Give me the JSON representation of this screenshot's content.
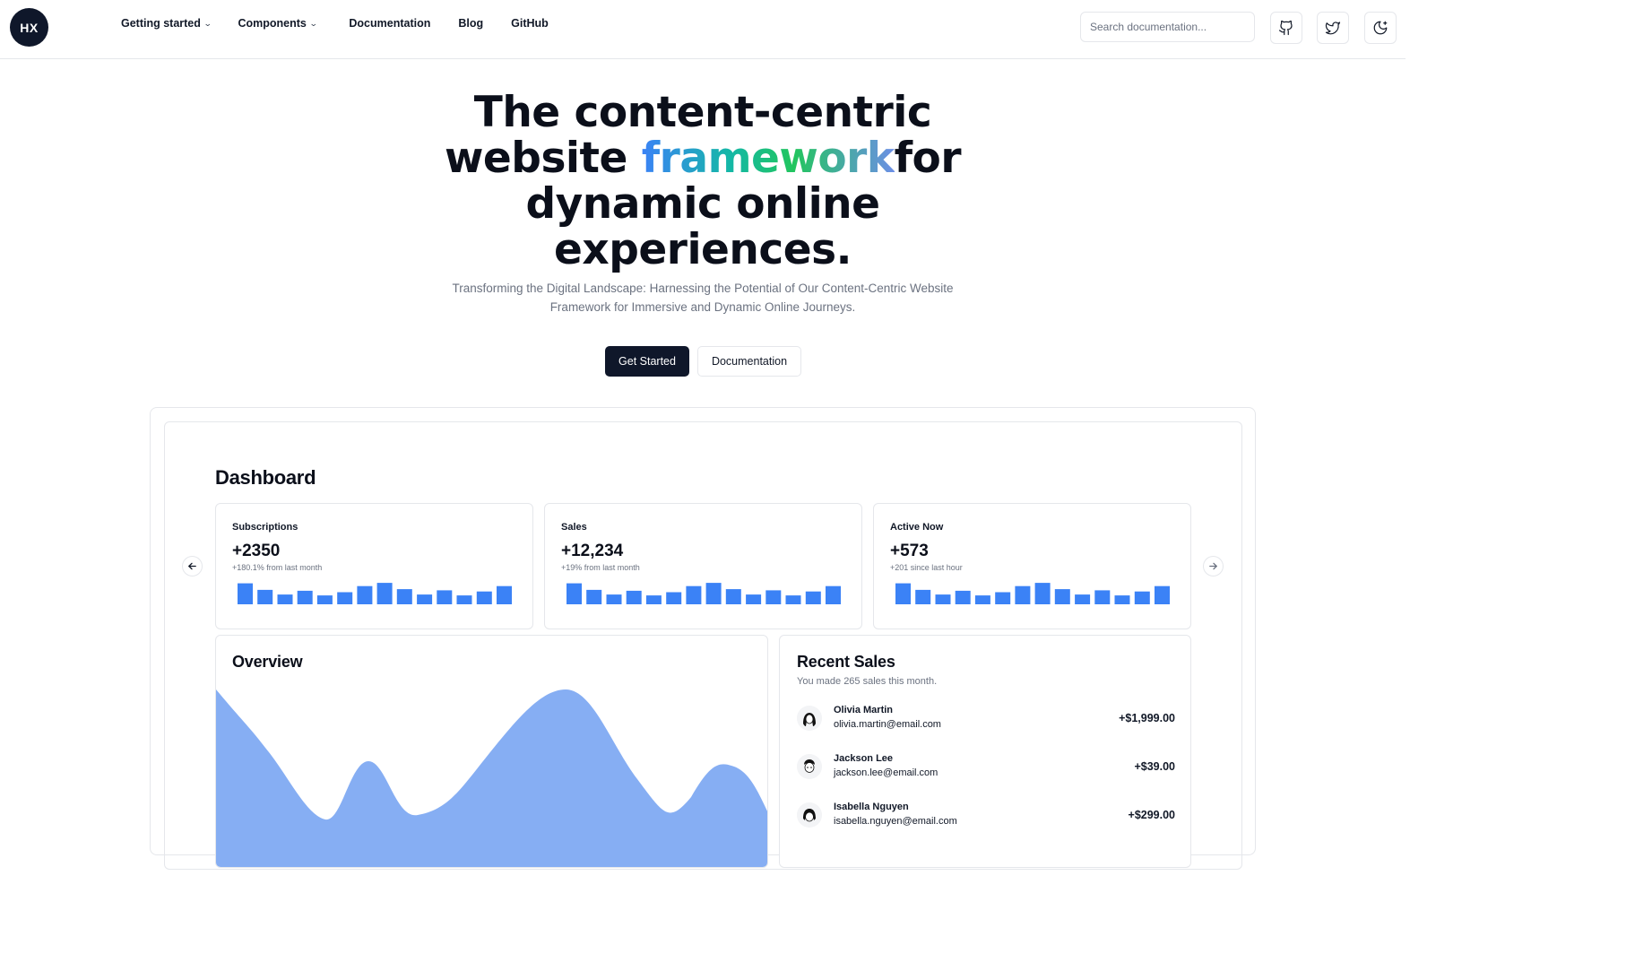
{
  "header": {
    "logo_text": "HX",
    "nav": [
      {
        "label": "Getting started",
        "has_dropdown": true
      },
      {
        "label": "Components",
        "has_dropdown": true
      },
      {
        "label": "Documentation",
        "has_dropdown": false
      },
      {
        "label": "Blog",
        "has_dropdown": false
      },
      {
        "label": "GitHub",
        "has_dropdown": false
      }
    ],
    "search_placeholder": "Search documentation...",
    "icons": [
      "github-icon",
      "twitter-icon",
      "theme-toggle-icon"
    ]
  },
  "hero": {
    "title_line1": "The content-centric",
    "title_line2_pre": "website ",
    "title_highlight": "framework",
    "title_line2_post": "for",
    "title_line3": "dynamic online",
    "title_line4": "experiences.",
    "subtitle_line1": "Transforming the Digital Landscape: Harnessing the Potential of Our Content-Centric Website",
    "subtitle_line2": "Framework for Immersive and Dynamic Online Journeys.",
    "primary_cta": "Get Started",
    "secondary_cta": "Documentation",
    "gradient_colors": [
      "#3b82f6",
      "#14b8a6",
      "#22c55e",
      "#6c8fe6"
    ]
  },
  "dashboard": {
    "title": "Dashboard",
    "accent_color": "#3b82f6",
    "stats": [
      {
        "label": "Subscriptions",
        "value": "+2350",
        "delta": "+180.1% from last month",
        "bars": [
          0.9,
          0.62,
          0.42,
          0.58,
          0.38,
          0.52,
          0.78,
          0.92,
          0.65,
          0.42,
          0.6,
          0.38,
          0.55,
          0.78
        ]
      },
      {
        "label": "Sales",
        "value": "+12,234",
        "delta": "+19% from last month",
        "bars": [
          0.9,
          0.62,
          0.42,
          0.58,
          0.38,
          0.52,
          0.78,
          0.92,
          0.65,
          0.42,
          0.6,
          0.38,
          0.55,
          0.78
        ]
      },
      {
        "label": "Active Now",
        "value": "+573",
        "delta": "+201 since last hour",
        "bars": [
          0.9,
          0.62,
          0.42,
          0.58,
          0.38,
          0.52,
          0.78,
          0.92,
          0.65,
          0.42,
          0.6,
          0.38,
          0.55,
          0.78
        ]
      }
    ],
    "overview": {
      "title": "Overview",
      "fill_color": "#86aef3"
    },
    "recent_sales": {
      "title": "Recent Sales",
      "subtitle": "You made 265 sales this month.",
      "rows": [
        {
          "name": "Olivia Martin",
          "email": "olivia.martin@email.com",
          "amount": "+$1,999.00"
        },
        {
          "name": "Jackson Lee",
          "email": "jackson.lee@email.com",
          "amount": "+$39.00"
        },
        {
          "name": "Isabella Nguyen",
          "email": "isabella.nguyen@email.com",
          "amount": "+$299.00"
        }
      ]
    }
  }
}
